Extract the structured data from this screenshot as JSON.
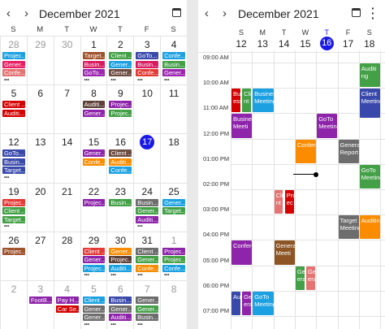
{
  "month_view": {
    "title": "December 2021",
    "weekdays": [
      "S",
      "M",
      "T",
      "W",
      "T",
      "F",
      "S"
    ],
    "weeks": [
      [
        {
          "d": "28",
          "other": true,
          "appts": [
            {
              "t": "Projec...",
              "c": "#1ba1e2"
            },
            {
              "t": "Gener...",
              "c": "#e91e63"
            },
            {
              "t": "Confe...",
              "c": "#e57373"
            }
          ],
          "more": true
        },
        {
          "d": "29",
          "other": true,
          "appts": []
        },
        {
          "d": "30",
          "other": true,
          "appts": []
        },
        {
          "d": "1",
          "appts": [
            {
              "t": "Target...",
              "c": "#a0522d"
            },
            {
              "t": "Busin...",
              "c": "#d81b60"
            },
            {
              "t": "GoTo...",
              "c": "#9c27b0"
            }
          ],
          "more": true
        },
        {
          "d": "2",
          "appts": [
            {
              "t": "Client ...",
              "c": "#43a047"
            },
            {
              "t": "Gener...",
              "c": "#1ba1e2"
            },
            {
              "t": "Gener...",
              "c": "#6d4c41"
            }
          ],
          "more": true
        },
        {
          "d": "3",
          "appts": [
            {
              "t": "GoTo...",
              "c": "#3949ab"
            },
            {
              "t": "Busin...",
              "c": "#d81b60"
            },
            {
              "t": "Confe...",
              "c": "#e53935"
            }
          ],
          "more": true
        },
        {
          "d": "4",
          "appts": [
            {
              "t": "Confe...",
              "c": "#1ba1e2"
            },
            {
              "t": "Busin...",
              "c": "#43a047"
            },
            {
              "t": "Gener...",
              "c": "#9c27b0"
            }
          ],
          "more": true
        }
      ],
      [
        {
          "d": "5",
          "appts": [
            {
              "t": "Client ...",
              "c": "#d50000"
            },
            {
              "t": "Auditi...",
              "c": "#d50000"
            }
          ]
        },
        {
          "d": "6",
          "appts": []
        },
        {
          "d": "7",
          "appts": []
        },
        {
          "d": "8",
          "appts": [
            {
              "t": "Auditi...",
              "c": "#5d4037"
            },
            {
              "t": "Gener...",
              "c": "#8e24aa"
            }
          ]
        },
        {
          "d": "9",
          "appts": [
            {
              "t": "Projec...",
              "c": "#8e24aa"
            },
            {
              "t": "Projec...",
              "c": "#43a047"
            }
          ]
        },
        {
          "d": "10",
          "appts": []
        },
        {
          "d": "11",
          "appts": []
        }
      ],
      [
        {
          "d": "12",
          "appts": [
            {
              "t": "GoTo...",
              "c": "#3949ab"
            },
            {
              "t": "Busin...",
              "c": "#3949ab"
            },
            {
              "t": "Target...",
              "c": "#3949ab"
            }
          ],
          "more": true
        },
        {
          "d": "13",
          "appts": []
        },
        {
          "d": "14",
          "appts": []
        },
        {
          "d": "15",
          "appts": [
            {
              "t": "Gener...",
              "c": "#8e24aa"
            },
            {
              "t": "Confe...",
              "c": "#fb8c00"
            }
          ]
        },
        {
          "d": "16",
          "appts": [
            {
              "t": "Client ...",
              "c": "#6d4c41"
            },
            {
              "t": "Auditi...",
              "c": "#fb8c00"
            },
            {
              "t": "Confe...",
              "c": "#1ba1e2"
            }
          ]
        },
        {
          "d": "17",
          "today": true,
          "appts": []
        },
        {
          "d": "18",
          "appts": []
        }
      ],
      [
        {
          "d": "19",
          "appts": [
            {
              "t": "Projec...",
              "c": "#e53935"
            },
            {
              "t": "Client ...",
              "c": "#43a047"
            },
            {
              "t": "Target...",
              "c": "#43a047"
            }
          ],
          "more": true
        },
        {
          "d": "20",
          "appts": []
        },
        {
          "d": "21",
          "appts": []
        },
        {
          "d": "22",
          "appts": [
            {
              "t": "Projec...",
              "c": "#8e24aa"
            }
          ]
        },
        {
          "d": "23",
          "appts": [
            {
              "t": "Busin...",
              "c": "#43a047"
            }
          ]
        },
        {
          "d": "24",
          "appts": [
            {
              "t": "Busin...",
              "c": "#6d6d6d"
            },
            {
              "t": "Gener...",
              "c": "#43a047"
            },
            {
              "t": "Auditi...",
              "c": "#8e24aa"
            }
          ],
          "more": true
        },
        {
          "d": "25",
          "appts": [
            {
              "t": "Gener...",
              "c": "#1ba1e2"
            },
            {
              "t": "Target...",
              "c": "#43a047"
            }
          ]
        }
      ],
      [
        {
          "d": "26",
          "appts": [
            {
              "t": "Projec...",
              "c": "#a0522d"
            }
          ]
        },
        {
          "d": "27",
          "appts": []
        },
        {
          "d": "28",
          "appts": []
        },
        {
          "d": "29",
          "appts": [
            {
              "t": "Client ...",
              "c": "#e53935"
            },
            {
              "t": "Gener...",
              "c": "#8e24aa"
            },
            {
              "t": "Projec...",
              "c": "#1ba1e2"
            }
          ],
          "more": true
        },
        {
          "d": "30",
          "appts": [
            {
              "t": "Gener...",
              "c": "#fb8c00"
            },
            {
              "t": "Projec...",
              "c": "#5d4037"
            },
            {
              "t": "Auditi...",
              "c": "#1ba1e2"
            }
          ],
          "more": true
        },
        {
          "d": "31",
          "appts": [
            {
              "t": "Client ...",
              "c": "#6d6d6d"
            },
            {
              "t": "Gener...",
              "c": "#43a047"
            },
            {
              "t": "Confe...",
              "c": "#fb8c00"
            }
          ],
          "more": true
        },
        {
          "d": "1",
          "other": true,
          "appts": [
            {
              "t": "Projec...",
              "c": "#8e24aa"
            },
            {
              "t": "Projec...",
              "c": "#43a047"
            },
            {
              "t": "Confe...",
              "c": "#1ba1e2"
            }
          ],
          "more": true
        }
      ],
      [
        {
          "d": "2",
          "other": true,
          "appts": []
        },
        {
          "d": "3",
          "other": true,
          "appts": [
            {
              "t": "FootB...",
              "c": "#8e24aa"
            }
          ]
        },
        {
          "d": "4",
          "other": true,
          "appts": [
            {
              "t": "Pay H...",
              "c": "#8e24aa"
            },
            {
              "t": "Car Se...",
              "c": "#d50000"
            }
          ]
        },
        {
          "d": "5",
          "other": true,
          "appts": [
            {
              "t": "Client ...",
              "c": "#1ba1e2"
            },
            {
              "t": "Gener...",
              "c": "#6d6d6d"
            },
            {
              "t": "Gener...",
              "c": "#6d6d6d"
            }
          ],
          "more": true
        },
        {
          "d": "6",
          "other": true,
          "appts": [
            {
              "t": "Busin...",
              "c": "#3949ab"
            },
            {
              "t": "Gener...",
              "c": "#6d6d6d"
            },
            {
              "t": "Auditi...",
              "c": "#8e24aa"
            }
          ],
          "more": true
        },
        {
          "d": "7",
          "other": true,
          "appts": [
            {
              "t": "Gener...",
              "c": "#6d6d6d"
            },
            {
              "t": "Gener...",
              "c": "#43a047"
            },
            {
              "t": "Busin...",
              "c": "#6d6d6d"
            }
          ],
          "more": true
        },
        {
          "d": "8",
          "other": true,
          "appts": []
        }
      ]
    ]
  },
  "week_view": {
    "title": "December 2021",
    "days": [
      {
        "dow": "S",
        "d": "12"
      },
      {
        "dow": "M",
        "d": "13"
      },
      {
        "dow": "T",
        "d": "14"
      },
      {
        "dow": "W",
        "d": "15"
      },
      {
        "dow": "T",
        "d": "16",
        "today": true
      },
      {
        "dow": "F",
        "d": "17"
      },
      {
        "dow": "S",
        "d": "18"
      }
    ],
    "times": [
      "09:00 AM",
      "10:00 AM",
      "11:00 AM",
      "12:00 PM",
      "01:00 PM",
      "02:00 PM",
      "03:00 PM",
      "04:00 PM",
      "05:00 PM",
      "06:00 PM",
      "07:00 PM"
    ],
    "appointments": [
      {
        "t": "Auditi ng",
        "c": "#43a047"
      },
      {
        "t": "Busi ess",
        "c": "#d50000"
      },
      {
        "t": "Clie nt",
        "c": "#43a047"
      },
      {
        "t": "Business Meeting",
        "c": "#1ba1e2"
      },
      {
        "t": "Client Meeting",
        "c": "#3949ab"
      },
      {
        "t": "Business Meeti",
        "c": "#8e24aa"
      },
      {
        "t": "GoTo Meeting",
        "c": "#8e24aa"
      },
      {
        "t": "Conference",
        "c": "#fb8c00"
      },
      {
        "t": "General Report",
        "c": "#6d6d6d"
      },
      {
        "t": "GoTo Meeting",
        "c": "#43a047"
      },
      {
        "t": "Clie nt",
        "c": "#e57373"
      },
      {
        "t": "Proj ec",
        "c": "#d50000"
      },
      {
        "t": "Target Meeting",
        "c": "#6d6d6d"
      },
      {
        "t": "Auditing",
        "c": "#fb8c00"
      },
      {
        "t": "Conference",
        "c": "#8e24aa"
      },
      {
        "t": "General Meeti",
        "c": "#8d5524"
      },
      {
        "t": "Gen eral",
        "c": "#43a047"
      },
      {
        "t": "Gen erat",
        "c": "#e57373"
      },
      {
        "t": "Audit",
        "c": "#3949ab"
      },
      {
        "t": "Gen eral",
        "c": "#8e24aa"
      },
      {
        "t": "GoTo Meeting",
        "c": "#1ba1e2"
      }
    ]
  },
  "colors": {
    "today": "#1a1ae8"
  }
}
